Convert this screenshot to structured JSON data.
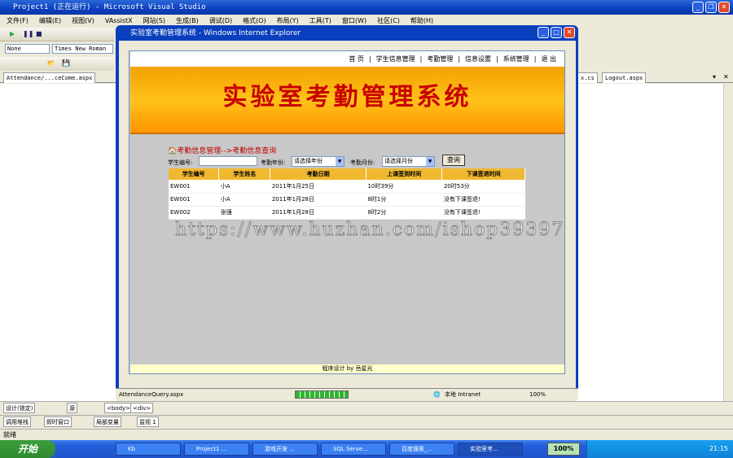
{
  "vs": {
    "title": "Project1 (正在运行) - Microsoft Visual Studio",
    "menu": [
      "文件(F)",
      "编辑(E)",
      "视图(V)",
      "VAssistX",
      "网站(S)",
      "生成(B)",
      "调试(D)",
      "格式(O)",
      "布局(Y)",
      "工具(T)",
      "窗口(W)",
      "社区(C)",
      "帮助(H)"
    ],
    "style_select": "None",
    "font_select": "Times New Roman",
    "doc_tab_left": "Attendance/...ceCome.aspx",
    "doc_tab_r1": "x.cs",
    "doc_tab_r2": "Logout.aspx",
    "design_tab": "设计(锁定)",
    "source_tab": "源",
    "tag_body": "<body>",
    "tag_div": "<div>",
    "bottom_tabs": [
      "调用堆栈",
      "即时窗口",
      "局部变量",
      "监视 1"
    ],
    "status": "就绪"
  },
  "ie": {
    "title": "实验室考勤管理系统 - Windows Internet Explorer",
    "status_url": "AttendanceQuery.aspx",
    "zone": "本地 Intranet",
    "zoom": "100%"
  },
  "page": {
    "nav": [
      "首 页",
      "学生信息管理",
      "考勤管理",
      "信息设置",
      "系统管理",
      "退 出"
    ],
    "nav_sep": "|",
    "banner_title": "实验室考勤管理系统",
    "breadcrumb": "考勤信息管理-->考勤信息查询",
    "filter": {
      "student_id_label": "学生编号:",
      "year_label": "考勤年份:",
      "year_value": "请选择年份",
      "month_label": "考勤月份:",
      "month_value": "请选择月份",
      "query_button": "查询"
    },
    "table": {
      "headers": [
        "学生编号",
        "学生姓名",
        "考勤日期",
        "上课签到时间",
        "下课签退时间"
      ],
      "rows": [
        [
          "EW001",
          "小A",
          "2011年1月25日",
          "10时39分",
          "20时53分"
        ],
        [
          "EW001",
          "小A",
          "2011年1月28日",
          "8时1分",
          "没有下课签退!"
        ],
        [
          "EW002",
          "张强",
          "2011年1月28日",
          "8时2分",
          "没有下课签退!"
        ]
      ]
    },
    "footer": "程序设计 by 岳星光",
    "watermark": "https://www.huzhan.com/ishop39397"
  },
  "taskbar": {
    "start": "开始",
    "items": [
      "Kb",
      "Project1 ...",
      "游戏开发 ...",
      "SQL Serve...",
      "百度搜索_...",
      "实验室考..."
    ],
    "zoom_badge": "100%",
    "clock": "21:15"
  }
}
